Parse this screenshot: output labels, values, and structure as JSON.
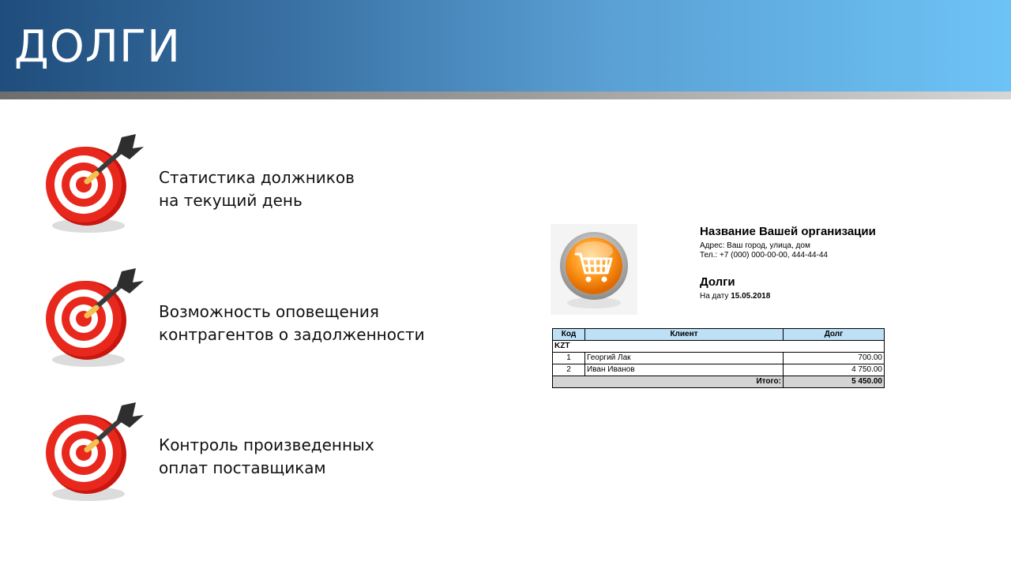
{
  "slide": {
    "title": "ДОЛГИ"
  },
  "bullets": [
    {
      "icon": "target-dart-icon",
      "line1": "Статистика должников",
      "line2": "на текущий день"
    },
    {
      "icon": "target-dart-icon",
      "line1": "Возможность оповещения",
      "line2": "контрагентов о задолженности"
    },
    {
      "icon": "target-dart-icon",
      "line1": "Контроль произведенных",
      "line2": "оплат поставщикам"
    }
  ],
  "report": {
    "logo_icon": "shopping-cart-icon",
    "org_name": "Название Вашей организации",
    "address": "Адрес: Ваш город, улица, дом",
    "phone": "Тел.: +7 (000) 000-00-00, 444-44-44",
    "title": "Долги",
    "date_label": "На дату",
    "date": "15.05.2018",
    "table": {
      "headers": [
        "Код",
        "Клиент",
        "Долг"
      ],
      "currency": "KZT",
      "rows": [
        {
          "code": "1",
          "client": "Георгий Лак",
          "debt": "700.00"
        },
        {
          "code": "2",
          "client": "Иван Иванов",
          "debt": "4 750.00"
        }
      ],
      "total_label": "Итого:",
      "total": "5 450.00"
    }
  }
}
